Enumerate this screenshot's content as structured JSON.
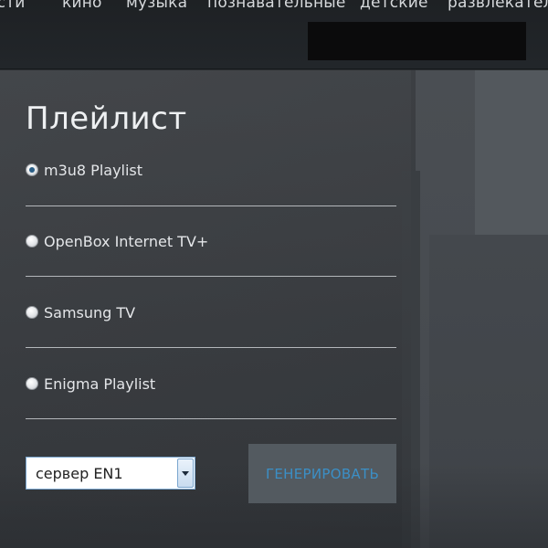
{
  "nav": {
    "items": [
      "ости",
      "кино",
      "музыка",
      "познавательные",
      "детские",
      "развлекатель"
    ]
  },
  "playlist": {
    "title": "Плейлист",
    "options": [
      {
        "label": "m3u8 Playlist",
        "checked": true
      },
      {
        "label": "OpenBox Internet TV+",
        "checked": false
      },
      {
        "label": "Samsung TV",
        "checked": false
      },
      {
        "label": "Enigma Playlist",
        "checked": false
      }
    ],
    "server_select": {
      "value": "сервер EN1"
    },
    "generate_label": "ГЕНЕРИРОВАТЬ"
  },
  "colors": {
    "nav_bg": "#1e2124",
    "page_bg": "#3f4246",
    "button_bg": "#535a60",
    "button_text": "#3b8fc6",
    "radio_selected": "#2a5e86"
  }
}
